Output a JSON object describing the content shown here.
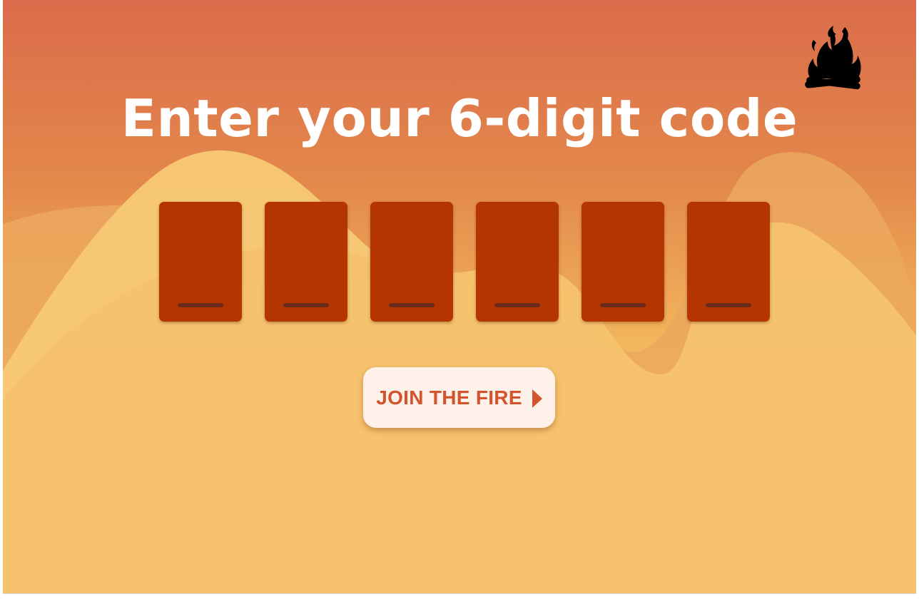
{
  "page": {
    "title": "Enter your 6-digit code"
  },
  "code": {
    "digits": [
      "",
      "",
      "",
      "",
      "",
      ""
    ]
  },
  "actions": {
    "join_label": "JOIN THE FIRE",
    "join_icon": "chevron-right-icon"
  },
  "brand": {
    "logo_icon": "campfire-icon",
    "logo_color": "#000000"
  },
  "colors": {
    "background_top": "#db6c4b",
    "background_bottom": "#f9b446",
    "digit_box": "#b43500",
    "digit_underline": "#6b2a1c",
    "button_background": "#fdf1ea",
    "button_text": "#d3532d",
    "title_text": "#ffffff"
  }
}
